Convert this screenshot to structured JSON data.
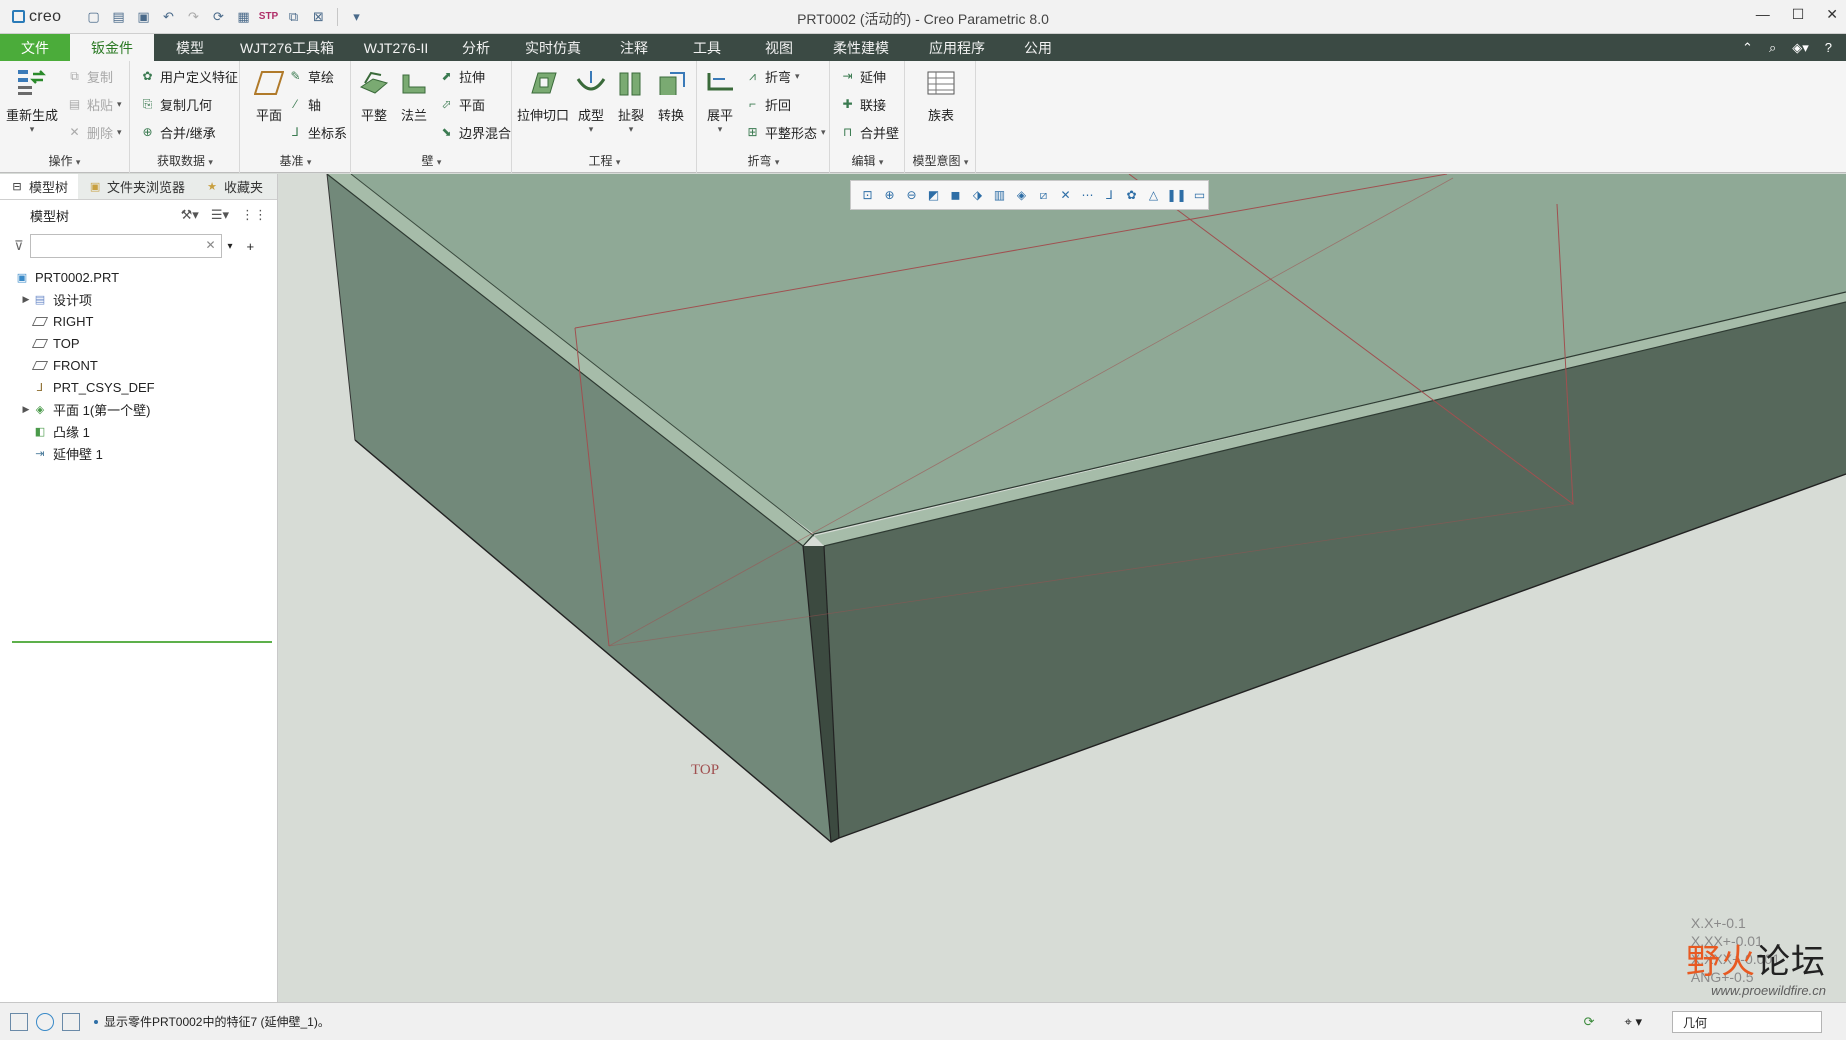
{
  "app": {
    "logo_text": "creo",
    "window_title": "PRT0002 (活动的) - Creo Parametric 8.0"
  },
  "window_controls": {
    "minimize": "—",
    "maximize": "☐",
    "close": "✕"
  },
  "tabs": [
    "文件",
    "钣金件",
    "模型",
    "WJT276工具箱",
    "WJT276-II",
    "分析",
    "实时仿真",
    "注释",
    "工具",
    "视图",
    "柔性建模",
    "应用程序",
    "公用"
  ],
  "active_tab": "钣金件",
  "ribbon": {
    "ops": {
      "label": "操作",
      "regen": "重新生成",
      "copy": "复制",
      "paste": "粘贴",
      "delete": "删除"
    },
    "getdata": {
      "label": "获取数据",
      "udf": "用户定义特征",
      "copygeom": "复制几何",
      "merge": "合并/继承"
    },
    "datum": {
      "label": "基准",
      "plane": "平面",
      "sketch": "草绘",
      "axis": "轴",
      "csys": "坐标系"
    },
    "wall": {
      "label": "壁",
      "planar": "平整",
      "flange": "法兰",
      "extrude": "拉伸",
      "plane": "平面",
      "blend": "边界混合"
    },
    "eng": {
      "label": "工程",
      "cut": "拉伸切口",
      "form": "成型",
      "rip": "扯裂",
      "convert": "转换"
    },
    "bend": {
      "label": "折弯",
      "unbend": "展平",
      "bend": "折弯",
      "bendback": "折回",
      "flatform": "平整形态"
    },
    "edit": {
      "label": "编辑",
      "extend": "延伸",
      "join": "联接",
      "mergewall": "合并壁"
    },
    "intent": {
      "label": "模型意图",
      "table": "族表"
    }
  },
  "panel": {
    "tabs": [
      "模型树",
      "文件夹浏览器",
      "收藏夹"
    ],
    "tree_title": "模型树",
    "filter_placeholder": "",
    "nodes": [
      {
        "label": "PRT0002.PRT"
      },
      {
        "label": "设计项"
      },
      {
        "label": "RIGHT"
      },
      {
        "label": "TOP"
      },
      {
        "label": "FRONT"
      },
      {
        "label": "PRT_CSYS_DEF"
      },
      {
        "label": "平面 1(第一个壁)"
      },
      {
        "label": "凸缘 1"
      },
      {
        "label": "延伸壁 1"
      }
    ]
  },
  "graphics": {
    "datum_label": "TOP",
    "accuracy": [
      "X.X+-0.1",
      "X.XX+-0.01",
      "X.XXX+-0.001",
      "ANG+-0.5"
    ],
    "watermark_main_orange": "野火",
    "watermark_main_dark": "论坛",
    "watermark_url": "www.proewildfire.cn"
  },
  "status": {
    "message": "显示零件PRT0002中的特征7 (延伸壁_1)。",
    "filter_value": "几何"
  },
  "colors": {
    "accent": "#4bac3a",
    "tabbar": "#3b4a44",
    "model_top": "#8fa996",
    "model_side": "#56685b",
    "datum": "#a05050"
  }
}
